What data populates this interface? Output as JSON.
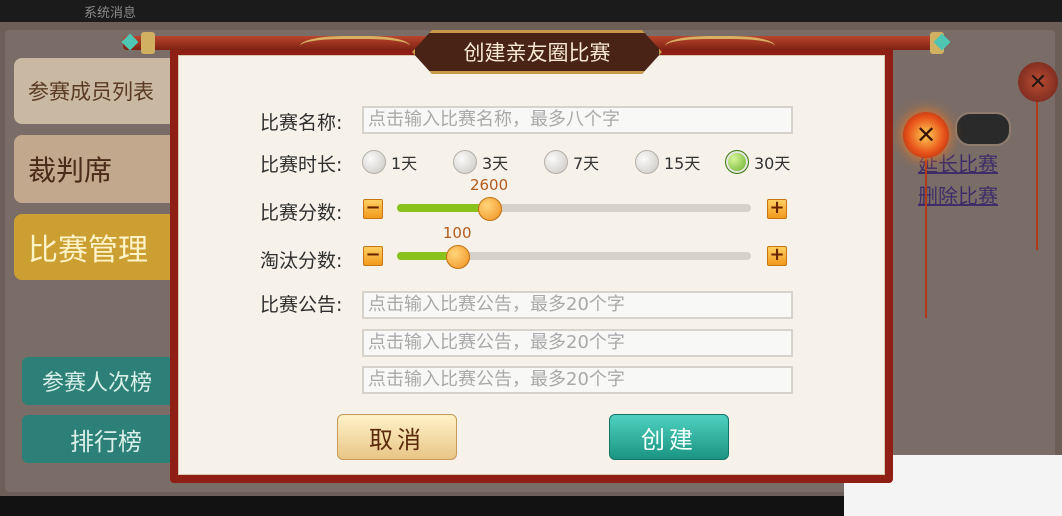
{
  "background": {
    "top_title": "系统消息",
    "side_buttons": [
      "参赛成员列表",
      "裁判席",
      "比赛管理"
    ],
    "teal_buttons": [
      "参赛人次榜",
      "排行榜"
    ],
    "right_links": [
      "延长比赛",
      "删除比赛"
    ]
  },
  "dialog": {
    "title": "创建亲友圈比赛",
    "name_label": "比赛名称:",
    "name_placeholder": "点击输入比赛名称，最多八个字",
    "duration_label": "比赛时长:",
    "duration_options": [
      "1天",
      "3天",
      "7天",
      "15天",
      "30天"
    ],
    "duration_selected": "30天",
    "score_label": "比赛分数:",
    "score_value": "2600",
    "score_fraction": 0.26,
    "elim_label": "淘汰分数:",
    "elim_value": "100",
    "elim_fraction": 0.17,
    "notice_label": "比赛公告:",
    "notice_placeholders": [
      "点击输入比赛公告，最多20个字",
      "点击输入比赛公告，最多20个字",
      "点击输入比赛公告，最多20个字"
    ],
    "minus_glyph": "−",
    "plus_glyph": "+",
    "cancel_label": "取消",
    "create_label": "创建"
  },
  "close_glyph": "✕",
  "colors": {
    "frame_red": "#8f1f14",
    "slider_fill": "#8ac21d",
    "create_teal": "#1b9483",
    "cancel_gold": "#e8c686"
  }
}
